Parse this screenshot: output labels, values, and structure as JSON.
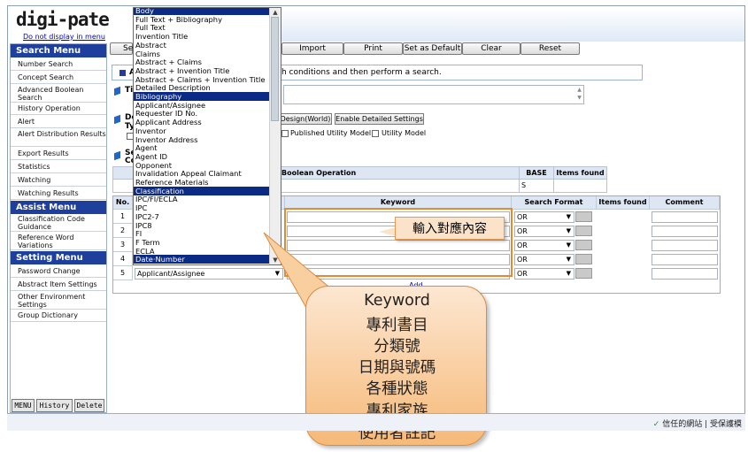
{
  "app": {
    "logo_text": "digi-pate",
    "hide_menu_link": "Do not display in menu"
  },
  "sidebar": {
    "search_menu_title": "Search Menu",
    "search_items": [
      "Number Search",
      "Concept Search",
      "Advanced Boolean Search",
      "History Operation",
      "Alert",
      "Alert Distribution Results",
      "Export Results",
      "Statistics",
      "Watching",
      "Watching Results"
    ],
    "assist_menu_title": "Assist Menu",
    "assist_items": [
      "Classification Code Guidance",
      "Reference Word Variations"
    ],
    "setting_menu_title": "Setting Menu",
    "setting_items": [
      "Password Change",
      "Abstract Item Settings",
      "Other Environment Settings",
      "Group Dictionary"
    ],
    "bottom_buttons": [
      "MENU",
      "History",
      "Delete"
    ]
  },
  "toolbar": {
    "partial_label": "Se",
    "buttons": [
      "Import",
      "Print",
      "Set as Default",
      "Clear",
      "Reset"
    ]
  },
  "info": {
    "partial_label": "A",
    "message": "ch conditions and then perform a search."
  },
  "form": {
    "title_label": "Ti",
    "doc_type_label": "Do",
    "doc_type_label2": "Ty",
    "select_label": "Se",
    "select_label2": "Co",
    "design_button": "Design(World)",
    "detailed_settings_button": "Enable Detailed Settings",
    "published_utility_model": "Published Utility Model",
    "utility_model": "Utility Model"
  },
  "boolean_table": {
    "header_boolean": "Boolean Operation",
    "header_base": "BASE",
    "header_items_found": "Items found",
    "base_value": "S"
  },
  "keyword_table": {
    "headers": {
      "no": "No.",
      "keyword": "Keyword",
      "search_format": "Search Format",
      "items_found": "Items found",
      "comment": "Comment"
    },
    "rows": [
      {
        "no": "1",
        "operator": "OR"
      },
      {
        "no": "2",
        "operator": "OR"
      },
      {
        "no": "3",
        "operator": "OR"
      },
      {
        "no": "4",
        "operator": "OR"
      },
      {
        "no": "5",
        "operator": "OR",
        "field": "Applicant/Assignee"
      }
    ],
    "add_link": "Add"
  },
  "dropdown": {
    "options": [
      "Body",
      "Full Text + Bibliography",
      "Full Text",
      "Invention Title",
      "Abstract",
      "Claims",
      "Abstract + Claims",
      "Abstract + Invention Title",
      "Abstract + Claims + Invention Title",
      "Detailed Description",
      "Bibliography",
      "Applicant/Assignee",
      "Requester ID No.",
      "Applicant Address",
      "Inventor",
      "Inventor Address",
      "Agent",
      "Agent ID",
      "Opponent",
      "Invalidation Appeal Claimant",
      "Reference Materials",
      "Classification",
      "IPC/FI/ECLA",
      "IPC",
      "IPC2-7",
      "IPC8",
      "FI",
      "F Term",
      "ECLA",
      "Date·Number"
    ],
    "highlighted": [
      "Body",
      "Bibliography",
      "Classification",
      "Date·Number"
    ]
  },
  "callouts": {
    "input_hint": "輸入對應內容",
    "bubble_lines": [
      "Keyword",
      "專利書目",
      "分類號",
      "日期與號碼",
      "各種狀態",
      "專利家族",
      "使用者註記"
    ]
  },
  "status_bar": {
    "text": "信任的網站 | 受保護模"
  },
  "colors": {
    "menu_header": "#1f3f9d",
    "highlight": "#0b2a86",
    "orange_border": "#e9892d",
    "bubble_fill": "#f6b978"
  }
}
